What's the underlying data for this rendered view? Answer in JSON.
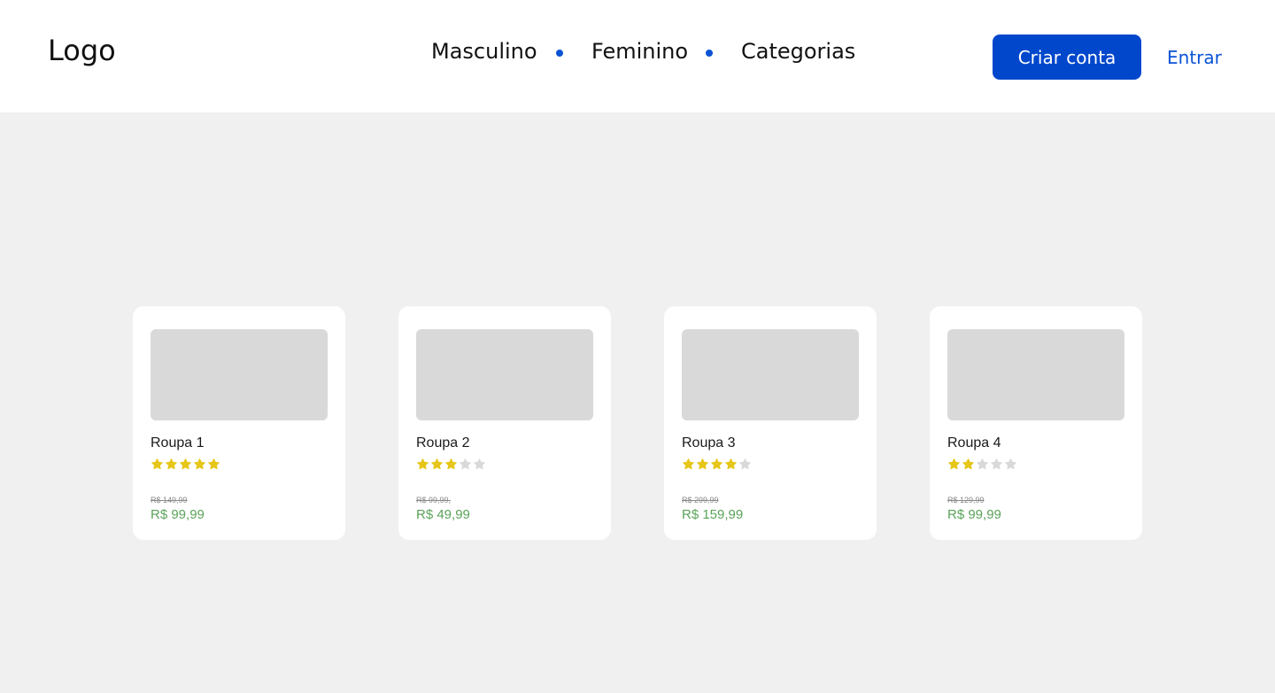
{
  "header": {
    "logo": "Logo",
    "nav": [
      "Masculino",
      "Feminino",
      "Categorias"
    ],
    "create_account_label": "Criar conta",
    "login_label": "Entrar"
  },
  "colors": {
    "accent": "#0047cc",
    "link": "#0a53d6",
    "star_filled": "#e6c619",
    "star_empty": "#d9d9d9",
    "price": "#5aa35a"
  },
  "products": [
    {
      "name": "Roupa 1",
      "rating": 5,
      "max_rating": 5,
      "old_price": "R$ 149,99",
      "price": "R$ 99,99"
    },
    {
      "name": "Roupa 2",
      "rating": 3,
      "max_rating": 5,
      "old_price": "R$ 99,99,",
      "price": "R$ 49,99"
    },
    {
      "name": "Roupa 3",
      "rating": 4,
      "max_rating": 5,
      "old_price": "R$ 299,99",
      "price": "R$ 159,99"
    },
    {
      "name": "Roupa 4",
      "rating": 2,
      "max_rating": 5,
      "old_price": "R$ 129,99",
      "price": "R$ 99,99"
    }
  ]
}
